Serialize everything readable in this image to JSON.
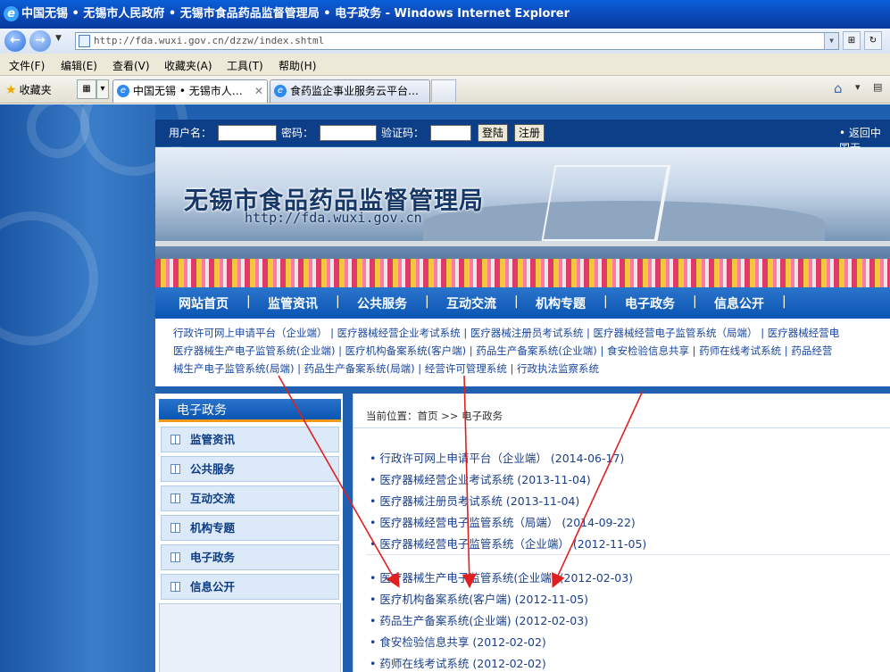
{
  "window": {
    "title": "中国无锡 • 无锡市人民政府 • 无锡市食品药品监督管理局 • 电子政务 - Windows Internet Explorer"
  },
  "browser": {
    "url": "http://fda.wuxi.gov.cn/dzzw/index.shtml",
    "menu": [
      "文件(F)",
      "编辑(E)",
      "查看(V)",
      "收藏夹(A)",
      "工具(T)",
      "帮助(H)"
    ],
    "favorites_label": "收藏夹",
    "tabs": [
      "中国无锡 • 无锡市人…",
      "食药监企事业服务云平台…"
    ]
  },
  "login": {
    "username_label": "用户名：",
    "password_label": "密码：",
    "captcha_label": "验证码：",
    "login_button": "登陆",
    "register_button": "注册",
    "back_link": "• 返回中国无"
  },
  "banner": {
    "title": "无锡市食品药品监督管理局",
    "url": "http://fda.wuxi.gov.cn"
  },
  "nav": [
    "网站首页",
    "监管资讯",
    "公共服务",
    "互动交流",
    "机构专题",
    "电子政务",
    "信息公开"
  ],
  "sublinks": [
    "行政许可网上申请平台（企业端） | 医疗器械经营企业考试系统 | 医疗器械注册员考试系统 | 医疗器械经营电子监管系统（局端） | 医疗器械经营电",
    "医疗器械生产电子监管系统(企业端) | 医疗机构备案系统(客户端) | 药品生产备案系统(企业端) | 食安检验信息共享 | 药师在线考试系统 | 药品经营",
    "械生产电子监管系统(局端) | 药品生产备案系统(局端) | 经营许可管理系统 | 行政执法监察系统"
  ],
  "sidebar": {
    "title": "电子政务",
    "items": [
      "监管资讯",
      "公共服务",
      "互动交流",
      "机构专题",
      "电子政务",
      "信息公开"
    ]
  },
  "main": {
    "breadcrumb": "当前位置：首页 >> 电子政务",
    "group1": [
      {
        "title": "行政许可网上申请平台（企业端）",
        "date": "(2014-06-17)"
      },
      {
        "title": "医疗器械经营企业考试系统",
        "date": "(2013-11-04)"
      },
      {
        "title": "医疗器械注册员考试系统",
        "date": "(2013-11-04)"
      },
      {
        "title": "医疗器械经营电子监管系统（局端）",
        "date": "(2014-09-22)"
      },
      {
        "title": "医疗器械经营电子监管系统（企业端）",
        "date": "(2012-11-05)"
      }
    ],
    "group2": [
      {
        "title": "医疗器械生产电子监管系统(企业端)",
        "date": "(2012-02-03)"
      },
      {
        "title": "医疗机构备案系统(客户端)",
        "date": "(2012-11-05)"
      },
      {
        "title": "药品生产备案系统(企业端)",
        "date": "(2012-02-03)"
      },
      {
        "title": "食安检验信息共享",
        "date": "(2012-02-02)"
      },
      {
        "title": "药师在线考试系统",
        "date": "(2012-02-02)"
      }
    ]
  },
  "colors": {
    "nav_blue": "#0b55b3",
    "accent_orange": "#f29a1a",
    "annotation_red": "#e02020"
  }
}
